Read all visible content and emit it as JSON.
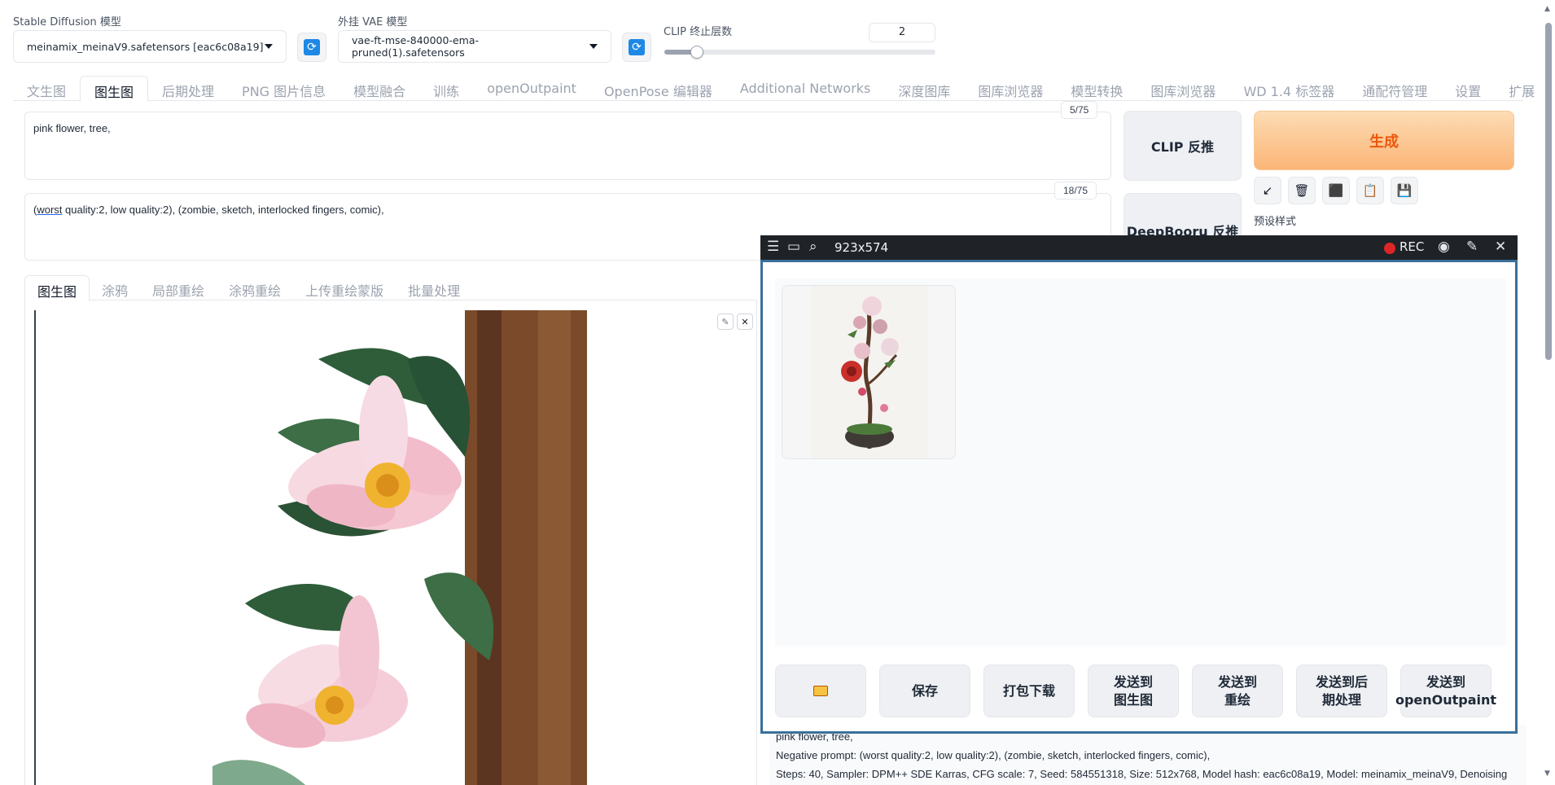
{
  "top": {
    "sd_model_label": "Stable Diffusion 模型",
    "sd_model_value": "meinamix_meinaV9.safetensors [eac6c08a19]",
    "vae_label": "外挂 VAE 模型",
    "vae_value": "vae-ft-mse-840000-ema-pruned(1).safetensors",
    "clip_label": "CLIP 终止层数",
    "clip_value": "2",
    "clip_slider_fraction": 0.12
  },
  "tabs": [
    "文生图",
    "图生图",
    "后期处理",
    "PNG 图片信息",
    "模型融合",
    "训练",
    "openOutpaint",
    "OpenPose 编辑器",
    "Additional Networks",
    "深度图库",
    "图库浏览器",
    "模型转换",
    "图库浏览器",
    "WD 1.4 标签器",
    "通配符管理",
    "设置",
    "扩展"
  ],
  "prompt": {
    "positive": "pink flower, tree,",
    "positive_count": "5/75",
    "negative_word": "worst",
    "negative_rest": " quality:2, low quality:2), (zombie, sketch, interlocked fingers, comic),",
    "negative_open": "(",
    "negative_count": "18/75"
  },
  "right": {
    "clip_btn": "CLIP 反推",
    "deepbooru_btn": "DeepBooru 反推",
    "generate_btn": "生成",
    "styles_label": "预设样式",
    "tools": [
      "↙",
      "🗑",
      "⬛",
      "📋",
      "💾"
    ]
  },
  "subtabs": [
    "图生图",
    "涂鸦",
    "局部重绘",
    "涂鸦重绘",
    "上传重绘蒙版",
    "批量处理"
  ],
  "recorder": {
    "dims": "923x574",
    "rec_label": "REC"
  },
  "actions": [
    "保存",
    "打包下载",
    "发送到 图生图",
    "发送到 重绘",
    "发送到后 期处理",
    "发送到 openOutpaint"
  ],
  "info": {
    "line1": "pink flower, tree,",
    "line2": "Negative prompt: (worst quality:2, low quality:2), (zombie, sketch, interlocked fingers, comic),",
    "line3": "Steps: 40, Sampler: DPM++ SDE Karras, CFG scale: 7, Seed: 584551318, Size: 512x768, Model hash: eac6c08a19, Model: meinamix_meinaV9, Denoising"
  },
  "colors": {
    "accent": "#ea580c",
    "recorder_frame": "#3b6f99",
    "refresh_blue": "#1e88e5"
  }
}
